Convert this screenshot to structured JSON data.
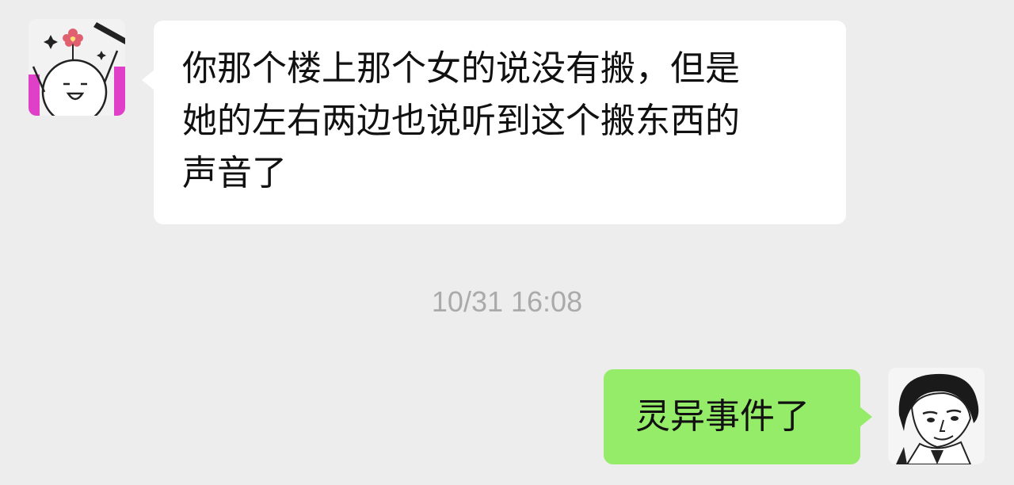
{
  "chat": {
    "incoming": {
      "avatar_icon": "cartoon-face-with-flower-icon",
      "lines": [
        "你那个楼上那个女的说没有搬，但是",
        "她的左右两边也说听到这个搬东西的",
        "声音了"
      ],
      "bubble_color": "#FFFFFF"
    },
    "timestamp": "10/31 16:08",
    "outgoing": {
      "avatar_icon": "manga-man-portrait-icon",
      "text": "灵异事件了",
      "bubble_color": "#95EC69"
    }
  },
  "colors": {
    "background": "#EDEDED",
    "timestamp_text": "#AAAAAA",
    "avatar_left_accent": "#E040C8"
  }
}
